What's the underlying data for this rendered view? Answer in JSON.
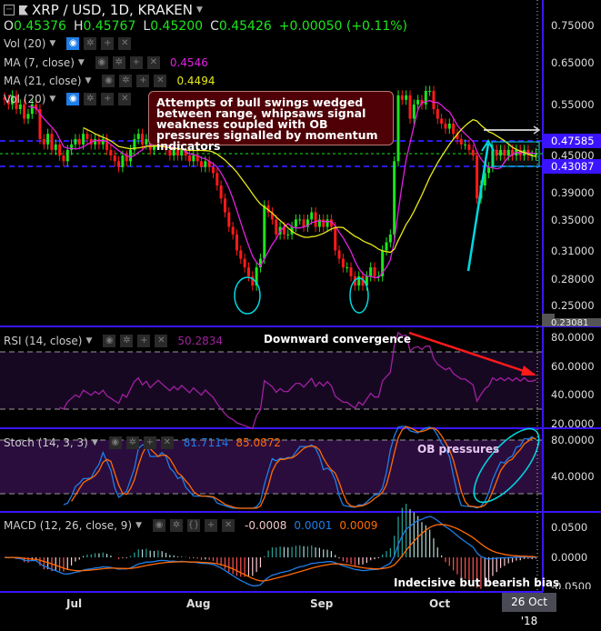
{
  "header": {
    "symbol_title": "XRP / USD, 1D, KRAKEN",
    "o_label": "O",
    "o": "0.45376",
    "h_label": "H",
    "h": "0.45767",
    "l_label": "L",
    "l": "0.45200",
    "c_label": "C",
    "c": "0.45426",
    "change": "+0.00050 (+0.11%)"
  },
  "indicators": [
    {
      "label": "Vol (20)",
      "value": ""
    },
    {
      "label": "MA (7, close)",
      "value": "0.4546"
    },
    {
      "label": "MA (21, close)",
      "value": "0.4494"
    },
    {
      "label": "Vol (20)",
      "value": ""
    }
  ],
  "price_axis": {
    "ticks": [
      "0.75000",
      "0.65000",
      "0.55000",
      "0.45000",
      "0.39000",
      "0.35000",
      "0.31000",
      "0.28000",
      "0.25000"
    ],
    "tags": [
      "0.47585",
      "0.43087"
    ],
    "bottom_tag": "0.23081"
  },
  "annotation_box": "Attempts of bull swings wedged between range, whipsaws signal weakness coupled with OB pressures signalled by momentum indicators",
  "rsi": {
    "label": "RSI (14, close)",
    "value": "50.2834",
    "note": "Downward convergence",
    "ticks": [
      "80.0000",
      "60.0000",
      "40.0000",
      "20.0000"
    ]
  },
  "stoch": {
    "label": "Stoch (14, 3, 3)",
    "k": "81.7114",
    "d": "85.0872",
    "note": "OB pressures",
    "ticks": [
      "80.0000",
      "40.0000"
    ]
  },
  "macd": {
    "label": "MACD (12, 26, close, 9)",
    "hist": "-0.0008",
    "macd": "0.0001",
    "signal": "0.0009",
    "note": "Indecisive but bearish bias",
    "ticks": [
      "0.0500",
      "0.0000",
      "-0.0500"
    ]
  },
  "time_axis": {
    "labels": [
      "Jul",
      "Aug",
      "Sep",
      "Oct"
    ],
    "cursor_date": "26 Oct '18"
  },
  "colors": {
    "up": "#1de51d",
    "down": "#ff1a1a",
    "ma7": "#e020e0",
    "ma21": "#e8e81a",
    "macd": "#1e7ee8",
    "signal": "#ff6a00",
    "rsi": "#a020a0",
    "separator": "#3a14ff",
    "annotation": "#00d8e0"
  },
  "chart_data": {
    "type": "candlestick",
    "title": "XRP / USD, 1D, KRAKEN",
    "x_range": [
      "2018-06-13",
      "2018-10-26"
    ],
    "y_scale": "log",
    "ylim": [
      0.23081,
      0.78
    ],
    "support_resistance": [
      0.47585,
      0.43087
    ],
    "close": [
      0.56,
      0.55,
      0.57,
      0.54,
      0.55,
      0.52,
      0.53,
      0.55,
      0.54,
      0.48,
      0.47,
      0.49,
      0.46,
      0.47,
      0.45,
      0.44,
      0.46,
      0.47,
      0.48,
      0.47,
      0.49,
      0.48,
      0.47,
      0.48,
      0.47,
      0.48,
      0.46,
      0.45,
      0.44,
      0.43,
      0.45,
      0.44,
      0.46,
      0.48,
      0.49,
      0.47,
      0.48,
      0.46,
      0.47,
      0.48,
      0.47,
      0.46,
      0.45,
      0.46,
      0.45,
      0.46,
      0.45,
      0.44,
      0.45,
      0.44,
      0.43,
      0.44,
      0.43,
      0.42,
      0.4,
      0.38,
      0.36,
      0.34,
      0.33,
      0.31,
      0.3,
      0.29,
      0.28,
      0.27,
      0.29,
      0.3,
      0.37,
      0.36,
      0.35,
      0.33,
      0.34,
      0.33,
      0.33,
      0.34,
      0.35,
      0.35,
      0.34,
      0.35,
      0.36,
      0.34,
      0.35,
      0.34,
      0.35,
      0.34,
      0.31,
      0.3,
      0.29,
      0.29,
      0.28,
      0.27,
      0.28,
      0.27,
      0.28,
      0.29,
      0.28,
      0.28,
      0.31,
      0.32,
      0.33,
      0.44,
      0.57,
      0.56,
      0.57,
      0.52,
      0.55,
      0.56,
      0.55,
      0.58,
      0.58,
      0.54,
      0.52,
      0.51,
      0.5,
      0.51,
      0.49,
      0.48,
      0.47,
      0.47,
      0.46,
      0.45,
      0.38,
      0.4,
      0.42,
      0.43,
      0.46,
      0.45,
      0.46,
      0.45,
      0.46,
      0.45,
      0.46,
      0.45,
      0.46,
      0.45,
      0.45,
      0.454
    ],
    "last_ohlc": {
      "open": 0.45376,
      "high": 0.45767,
      "low": 0.452,
      "close": 0.45426
    },
    "series": [
      {
        "name": "MA (7, close)",
        "last": 0.4546
      },
      {
        "name": "MA (21, close)",
        "last": 0.4494
      }
    ]
  }
}
